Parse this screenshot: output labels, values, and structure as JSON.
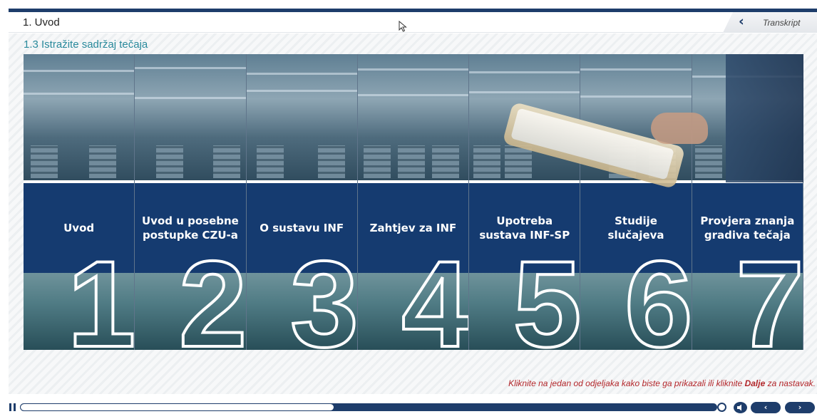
{
  "header": {
    "lesson_title": "1. Uvod",
    "transcript_label": "Transkript"
  },
  "content": {
    "section_title": "1.3 Istražite sadržaj tečaja",
    "tiles": [
      {
        "number": "1",
        "label": "Uvod"
      },
      {
        "number": "2",
        "label": "Uvod u posebne postupke CZU-a"
      },
      {
        "number": "3",
        "label": "O sustavu INF"
      },
      {
        "number": "4",
        "label": "Zahtjev za INF"
      },
      {
        "number": "5",
        "label": "Upotreba sustava INF-SP"
      },
      {
        "number": "6",
        "label": "Studije slučajeva"
      },
      {
        "number": "7",
        "label": "Provjera znanja gradiva tečaja"
      }
    ],
    "hint": {
      "before": "Kliknite na jedan od odjeljaka kako biste ga prikazali ili kliknite ",
      "bold": "Dalje",
      "after": " za nastavak."
    }
  },
  "playbar": {
    "progress": 0.45
  },
  "colors": {
    "navy": "#1e3d6b",
    "band": "#153b70",
    "section_title": "#2a8a9c",
    "hint": "#b3272b"
  }
}
